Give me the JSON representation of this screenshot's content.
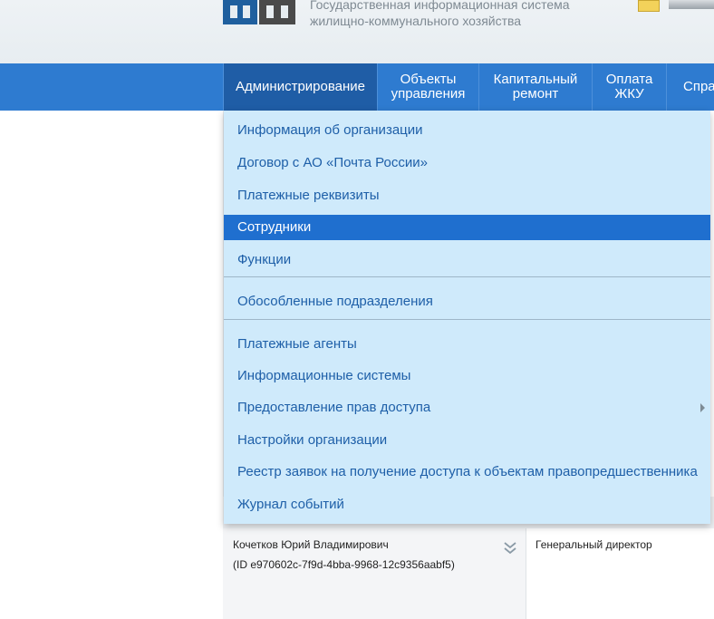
{
  "header": {
    "title_line1": "Государственная информационная система",
    "title_line2": "жилищно-коммунального хозяйства"
  },
  "nav": {
    "items": [
      {
        "line1": "Администрирование",
        "line2": ""
      },
      {
        "line1": "Объекты",
        "line2": "управления"
      },
      {
        "line1": "Капитальный",
        "line2": "ремонт"
      },
      {
        "line1": "Оплата",
        "line2": "ЖКУ"
      },
      {
        "line1": "Справ",
        "line2": ""
      }
    ],
    "active_index": 0
  },
  "dropdown": {
    "items": [
      {
        "label": "Информация об организации"
      },
      {
        "label": "Договор с АО «Почта России»"
      },
      {
        "label": "Платежные реквизиты"
      },
      {
        "label": "Сотрудники",
        "selected": true
      },
      {
        "label": "Функции"
      },
      {
        "label": "Обособленные подразделения"
      },
      {
        "label": "Платежные агенты"
      },
      {
        "label": "Информационные системы"
      },
      {
        "label": "Предоставление прав доступа",
        "has_submenu": true
      },
      {
        "label": "Настройки организации"
      },
      {
        "label": "Реестр заявок на получение доступа к объектам правопредшественника"
      },
      {
        "label": "Журнал событий"
      }
    ]
  },
  "table": {
    "row": {
      "name": "Кочетков Юрий Владимирович",
      "id": "(ID e970602c-7f9d-4bba-9968-12c9356aabf5)",
      "position": "Генеральный директор"
    }
  },
  "colors": {
    "nav_bg": "#2e7bd0",
    "nav_active": "#1f5da6",
    "menu_bg": "#cfeafb",
    "menu_text": "#1e5fa8",
    "menu_selected": "#1f6fcf"
  }
}
